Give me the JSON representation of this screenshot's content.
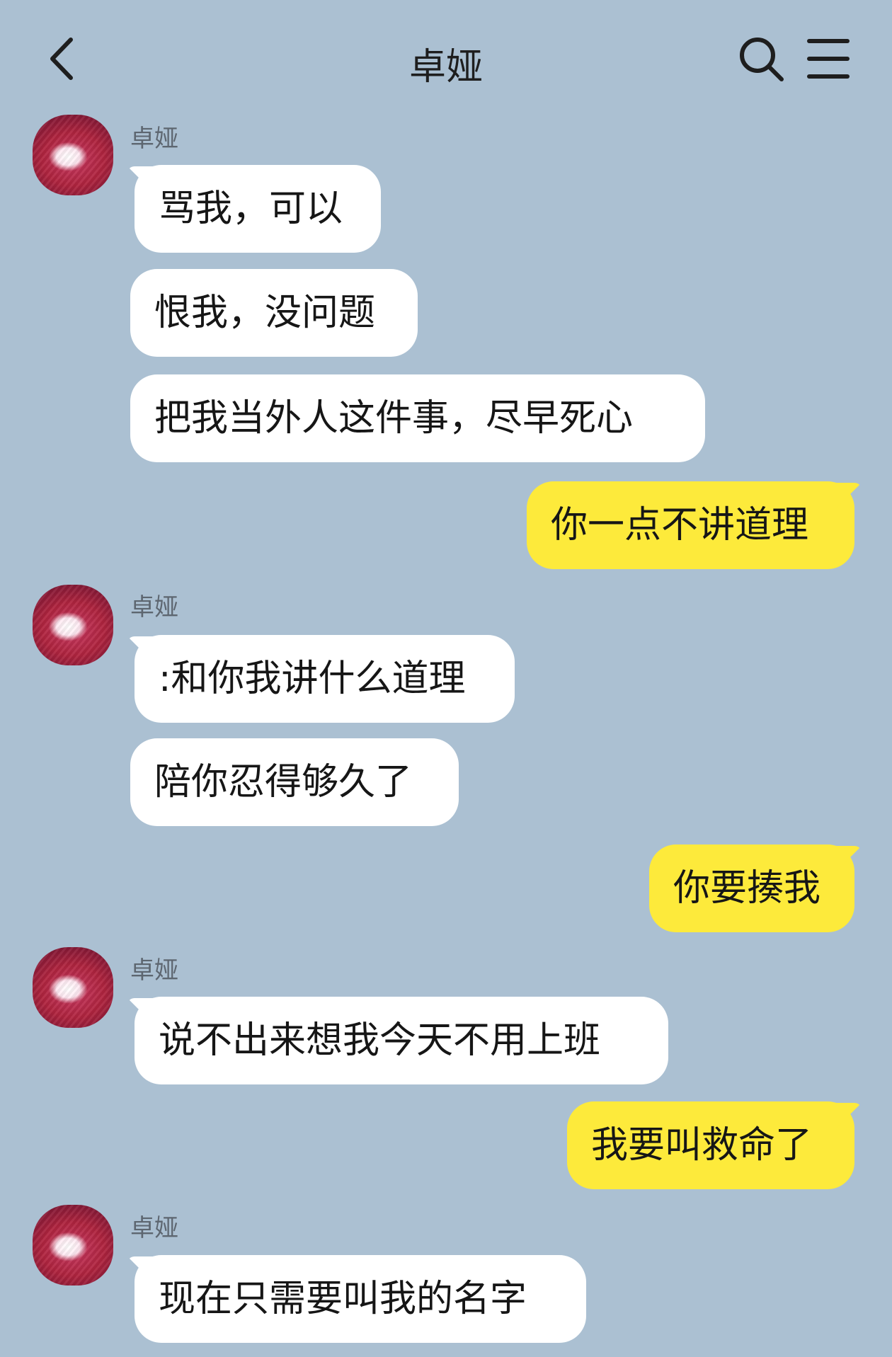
{
  "header": {
    "title": "卓娅",
    "back_icon": "chevron-left-icon",
    "search_icon": "search-icon",
    "menu_icon": "hamburger-menu-icon"
  },
  "colors": {
    "background": "#abc0d2",
    "incoming_bubble": "#ffffff",
    "outgoing_bubble": "#fdea3b"
  },
  "messages": [
    {
      "sender": "卓娅",
      "text": "骂我，可以"
    },
    {
      "text": "恨我，没问题"
    },
    {
      "text": "把我当外人这件事，尽早死心"
    },
    {
      "text": "你一点不讲道理"
    },
    {
      "sender": "卓娅",
      "text": ":和你我讲什么道理"
    },
    {
      "text": "陪你忍得够久了"
    },
    {
      "text": "你要揍我"
    },
    {
      "sender": "卓娅",
      "text": "说不出来想我今天不用上班"
    },
    {
      "text": "我要叫救命了"
    },
    {
      "sender": "卓娅",
      "text": "现在只需要叫我的名字"
    }
  ]
}
